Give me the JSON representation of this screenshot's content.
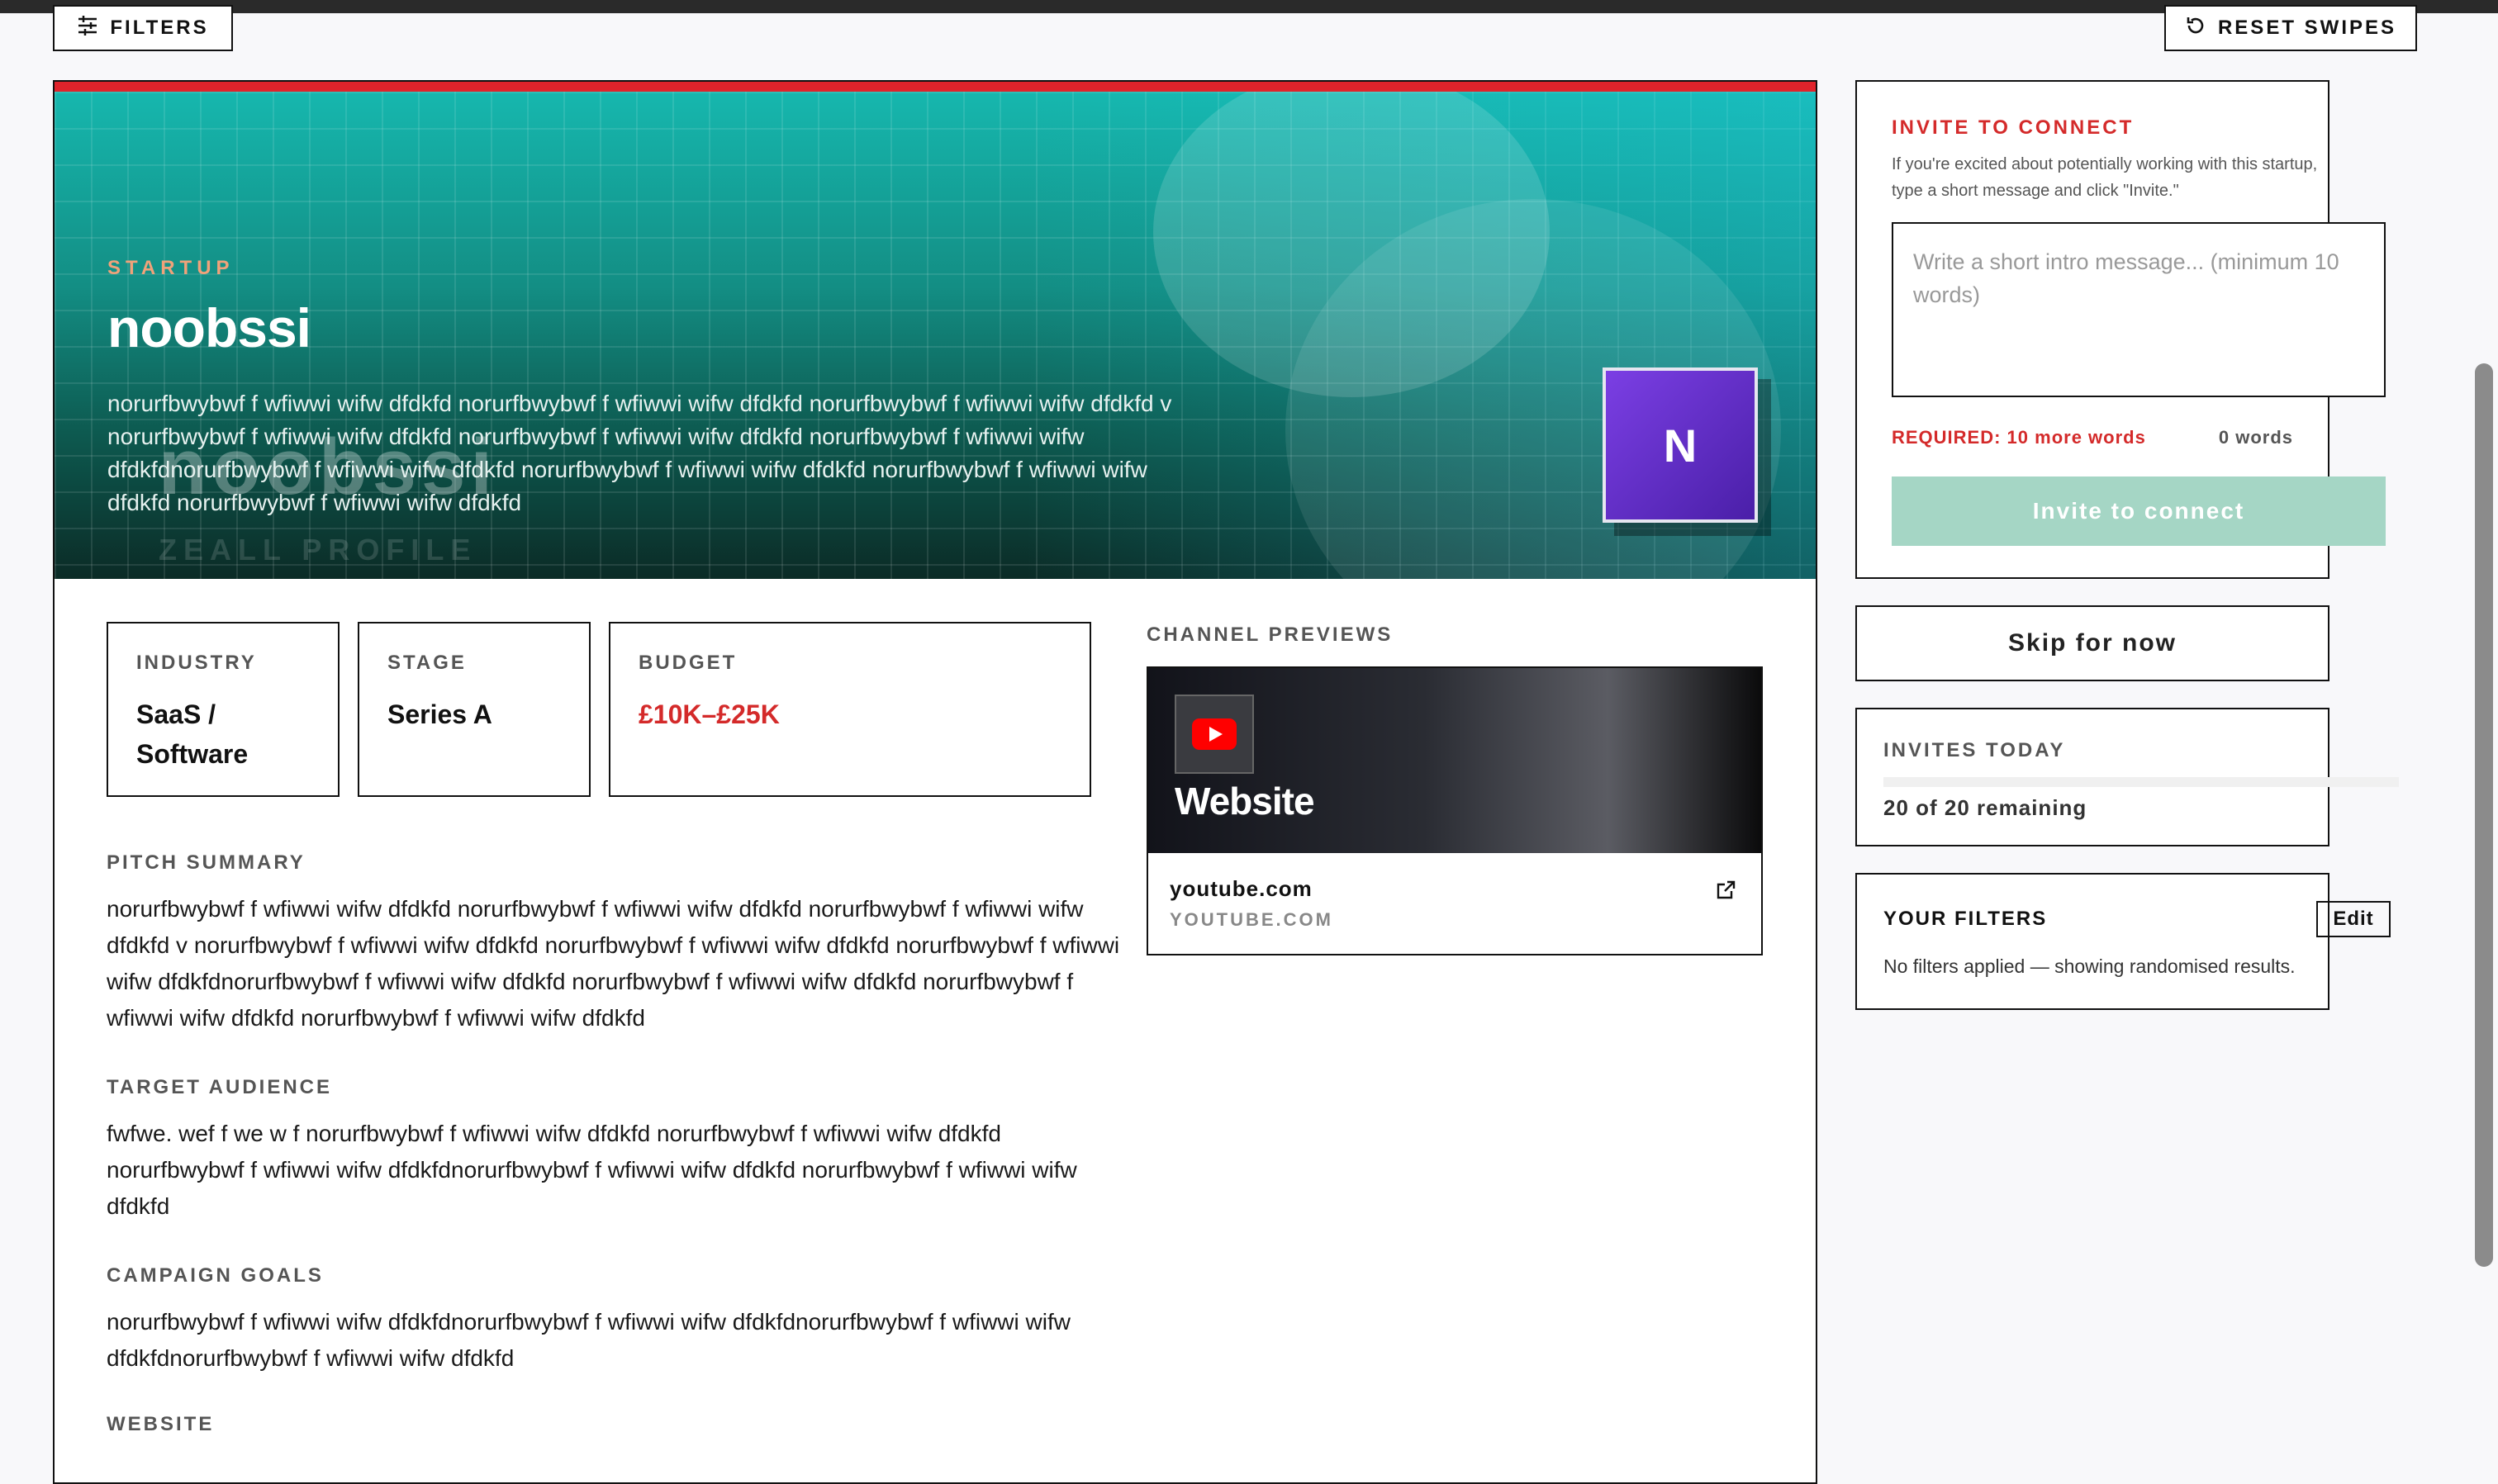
{
  "toolbar": {
    "filters_label": "FILTERS",
    "reset_label": "RESET SWIPES"
  },
  "hero": {
    "label": "STARTUP",
    "title": "noobssi",
    "description": "norurfbwybwf f wfiwwi wifw dfdkfd norurfbwybwf f wfiwwi wifw dfdkfd norurfbwybwf f wfiwwi wifw dfdkfd v norurfbwybwf f wfiwwi wifw dfdkfd norurfbwybwf f wfiwwi wifw dfdkfd norurfbwybwf f wfiwwi wifw dfdkfdnorurfbwybwf f wfiwwi wifw dfdkfd norurfbwybwf f wfiwwi wifw dfdkfd norurfbwybwf f wfiwwi wifw dfdkfd norurfbwybwf f wfiwwi wifw dfdkfd",
    "watermark": "noobssi",
    "watermark_sub": "ZEALL PROFILE",
    "avatar_letter": "N"
  },
  "stats": {
    "industry_label": "INDUSTRY",
    "industry_value": "SaaS / Software",
    "stage_label": "STAGE",
    "stage_value": "Series A",
    "budget_label": "BUDGET",
    "budget_value": "£10K–£25K"
  },
  "sections": {
    "pitch_label": "PITCH SUMMARY",
    "pitch_text": "norurfbwybwf f wfiwwi wifw dfdkfd norurfbwybwf f wfiwwi wifw dfdkfd norurfbwybwf f wfiwwi wifw dfdkfd v norurfbwybwf f wfiwwi wifw dfdkfd norurfbwybwf f wfiwwi wifw dfdkfd norurfbwybwf f wfiwwi wifw dfdkfdnorurfbwybwf f wfiwwi wifw dfdkfd norurfbwybwf f wfiwwi wifw dfdkfd norurfbwybwf f wfiwwi wifw dfdkfd norurfbwybwf f wfiwwi wifw dfdkfd",
    "audience_label": "TARGET AUDIENCE",
    "audience_text": "fwfwe. wef f we w f norurfbwybwf f wfiwwi wifw dfdkfd norurfbwybwf f wfiwwi wifw dfdkfd norurfbwybwf f wfiwwi wifw dfdkfdnorurfbwybwf f wfiwwi wifw dfdkfd norurfbwybwf f wfiwwi wifw dfdkfd",
    "goals_label": "CAMPAIGN GOALS",
    "goals_text": "norurfbwybwf f wfiwwi wifw dfdkfdnorurfbwybwf f wfiwwi wifw dfdkfdnorurfbwybwf f wfiwwi wifw dfdkfdnorurfbwybwf f wfiwwi wifw dfdkfd",
    "website_label": "WEBSITE"
  },
  "channels": {
    "label": "CHANNEL PREVIEWS",
    "card_title": "Website",
    "host": "youtube.com",
    "host_upper": "YOUTUBE.COM",
    "icon": "youtube-icon"
  },
  "invite": {
    "title": "INVITE TO CONNECT",
    "subtitle": "If you're excited about potentially working with this startup, type a short message and click \"Invite.\"",
    "placeholder": "Write a short intro message... (minimum 10 words)",
    "required_text": "REQUIRED: 10 more words",
    "word_count": "0 words",
    "button_label": "Invite to connect",
    "button_color": "#a5d6c5"
  },
  "skip": {
    "label": "Skip for now"
  },
  "invites_today": {
    "label": "INVITES TODAY",
    "status": "20 of 20 remaining",
    "used_fraction": 0
  },
  "your_filters": {
    "label": "YOUR FILTERS",
    "edit_label": "Edit",
    "text": "No filters applied — showing randomised results."
  },
  "colors": {
    "accent_red": "#d42a2a",
    "hero_top_bar": "#e0232b",
    "avatar": "#6a33d0",
    "budget": "#d42a2a"
  }
}
